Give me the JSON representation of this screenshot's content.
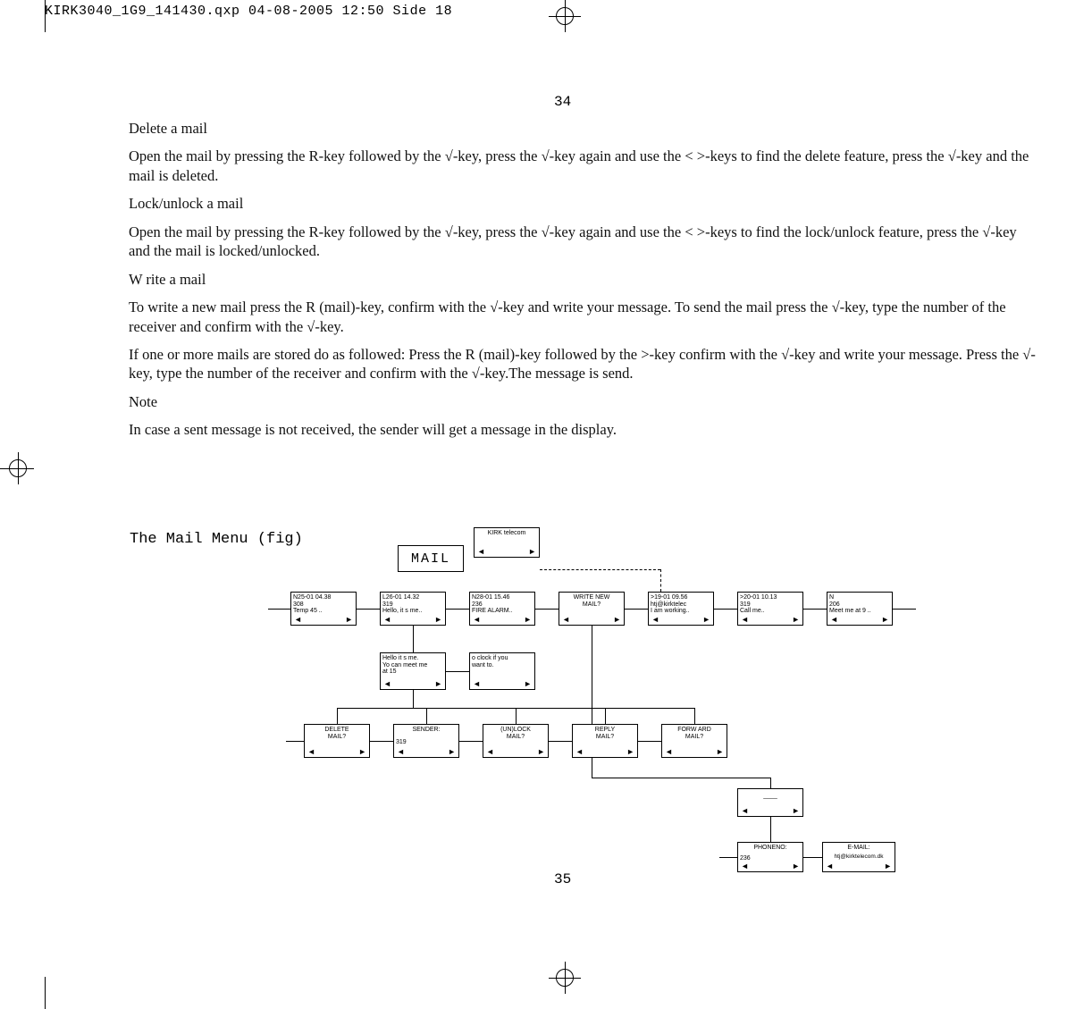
{
  "print_header": "KIRK3040_1G9_141430.qxp  04-08-2005  12:50  Side 18",
  "page_top": "34",
  "page_bottom": "35",
  "sections": {
    "delete_h": "Delete a mail",
    "delete_p": "Open the mail by pressing the R-key followed by the √-key, press the √-key again and use the < >-keys to find the delete feature, press the √-key and the mail is deleted.",
    "lock_h": "Lock/unlock a mail",
    "lock_p": "Open the mail by pressing the R-key followed by the √-key, press the √-key again and use the < >-keys to find the lock/unlock feature, press the √-key and the mail is locked/unlocked.",
    "write_h": "W rite a mail",
    "write_p1": "To write a new mail press the R (mail)-key, confirm with the √-key and write your message. To send the mail press the √-key, type the number of the receiver and confirm with the √-key.",
    "write_p2": "If one or more mails are stored do as followed: Press the R (mail)-key followed by the >-key confirm with the √-key and write your message. Press the √-key, type the number of the receiver and confirm with the √-key.The message is send.",
    "note_h": "Note",
    "note_p": "In case a sent message is not received, the sender will get a message in the display."
  },
  "fig_title": "The Mail Menu (fig)",
  "diagram": {
    "mail_label": "MAIL",
    "kirk": "KIRK telecom",
    "row1": {
      "b1": "N25-01 04.38\n308\nTemp 45 ..",
      "b2": "L26-01 14.32\n319\nHello, it s me..",
      "b3": "N28-01 15.46\n236\nFIRE ALARM..",
      "b4": "WRITE NEW\nMAIL?",
      "b5": ">19-01 09.56\nhtj@kirktelec\nI am working..",
      "b6": ">20-01 10.13\n319\nCall me..",
      "b7": "N\n206\nMeet me at 9 .."
    },
    "msg_a": "Hello it s me.\nYo can meet me\nat 15",
    "msg_b": "o clock if you\nwant to.",
    "row3": {
      "delete": "DELETE\nMAIL?",
      "sender_h": "SENDER:",
      "sender_v": "319",
      "unlock": "(UN)LOCK\nMAIL?",
      "reply": "REPLY\nMAIL?",
      "forward": "FORW ARD\nMAIL?"
    },
    "dashes": "____",
    "phoneno_h": "PHONENO:",
    "phoneno_v": "236",
    "email_h": "E-MAIL:",
    "email_v": "htj@kirktelecom.dk"
  }
}
